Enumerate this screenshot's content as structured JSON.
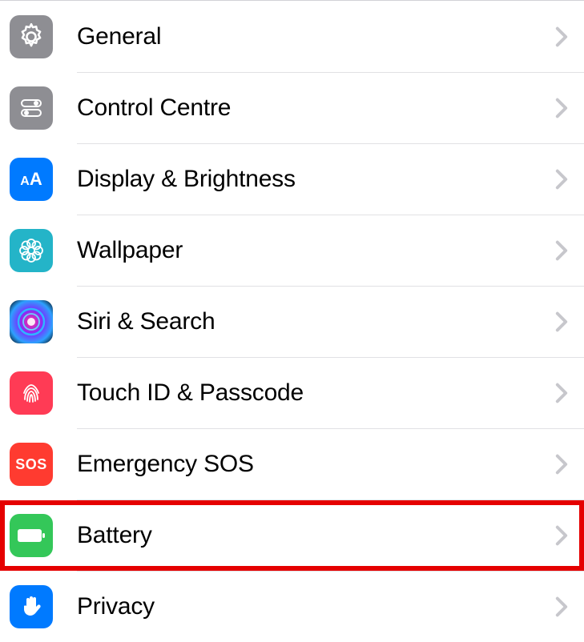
{
  "settings": {
    "items": [
      {
        "label": "General"
      },
      {
        "label": "Control Centre"
      },
      {
        "label": "Display & Brightness"
      },
      {
        "label": "Wallpaper"
      },
      {
        "label": "Siri & Search"
      },
      {
        "label": "Touch ID & Passcode"
      },
      {
        "label": "Emergency SOS"
      },
      {
        "label": "Battery"
      },
      {
        "label": "Privacy"
      }
    ],
    "sos_text": "SOS",
    "aa_text": "AA",
    "highlighted_index": 7
  }
}
